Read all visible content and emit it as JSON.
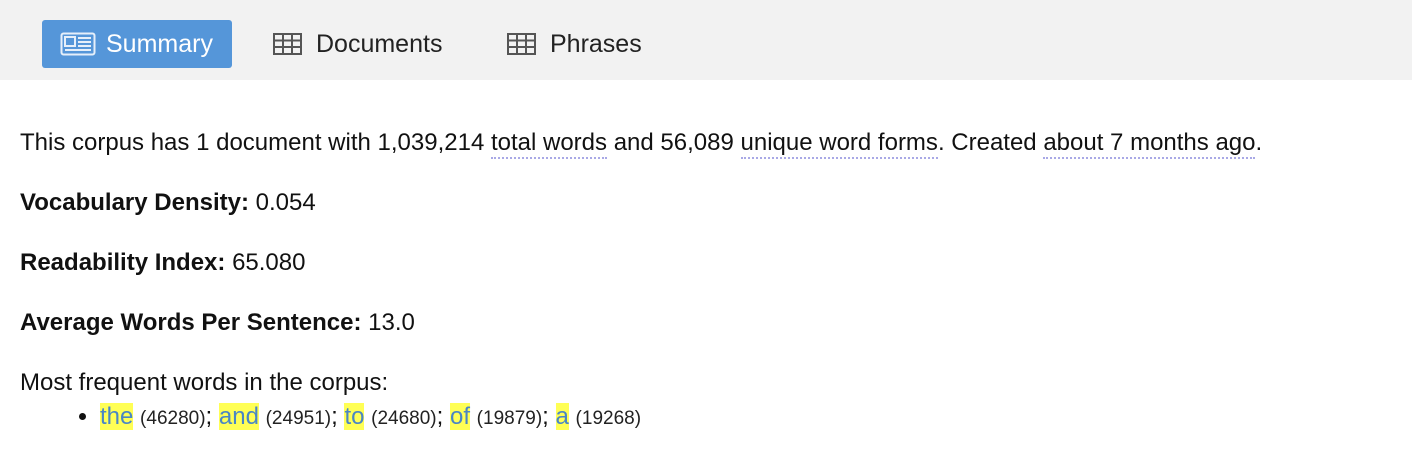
{
  "tabs": {
    "summary": {
      "label": "Summary",
      "icon": "newspaper-icon",
      "active": true,
      "color": "#5596d9"
    },
    "documents": {
      "label": "Documents",
      "icon": "table-icon"
    },
    "phrases": {
      "label": "Phrases",
      "icon": "table-icon"
    }
  },
  "summary": {
    "prefix": "This corpus has 1 document with ",
    "total_words_value": "1,039,214",
    "total_words_label": "total words",
    "and": " and ",
    "unique_value": "56,089",
    "unique_label": "unique word forms",
    "created_prefix": ". Created ",
    "created_ago": "about 7 months ago",
    "suffix": "."
  },
  "stats": {
    "vocab": {
      "label": "Vocabulary Density:",
      "value": "0.054"
    },
    "readability": {
      "label": "Readability Index:",
      "value": "65.080"
    },
    "avg_words": {
      "label": "Average Words Per Sentence:",
      "value": "13.0"
    }
  },
  "frequent": {
    "heading": "Most frequent words in the corpus:",
    "highlight_color": "#ffff55",
    "words": [
      {
        "word": "the",
        "count": "(46280)"
      },
      {
        "word": "and",
        "count": "(24951)"
      },
      {
        "word": "to",
        "count": "(24680)"
      },
      {
        "word": "of",
        "count": "(19879)"
      },
      {
        "word": "a",
        "count": "(19268)"
      }
    ],
    "separator": "; "
  }
}
